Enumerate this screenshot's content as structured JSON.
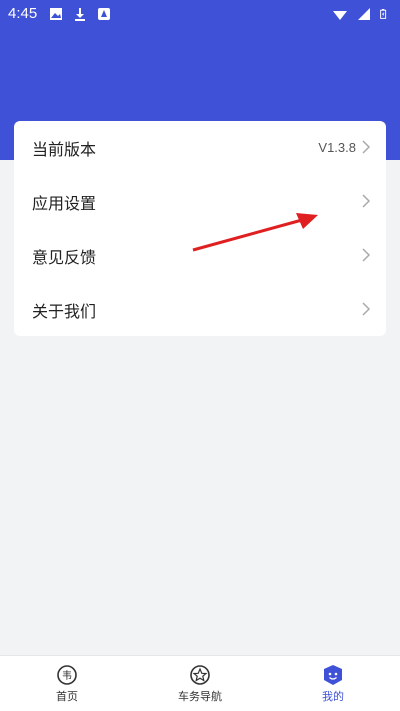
{
  "status": {
    "time": "4:45"
  },
  "menu": {
    "items": [
      {
        "label": "当前版本",
        "value": "V1.3.8"
      },
      {
        "label": "应用设置"
      },
      {
        "label": "意见反馈"
      },
      {
        "label": "关于我们"
      }
    ]
  },
  "nav": {
    "items": [
      {
        "label": "首页",
        "icon": "home-icon",
        "active": false
      },
      {
        "label": "车务导航",
        "icon": "star-icon",
        "active": false
      },
      {
        "label": "我的",
        "icon": "profile-icon",
        "active": true
      }
    ]
  },
  "colors": {
    "accent": "#3f51d6",
    "background": "#f2f3f5",
    "arrow": "#e02020"
  }
}
